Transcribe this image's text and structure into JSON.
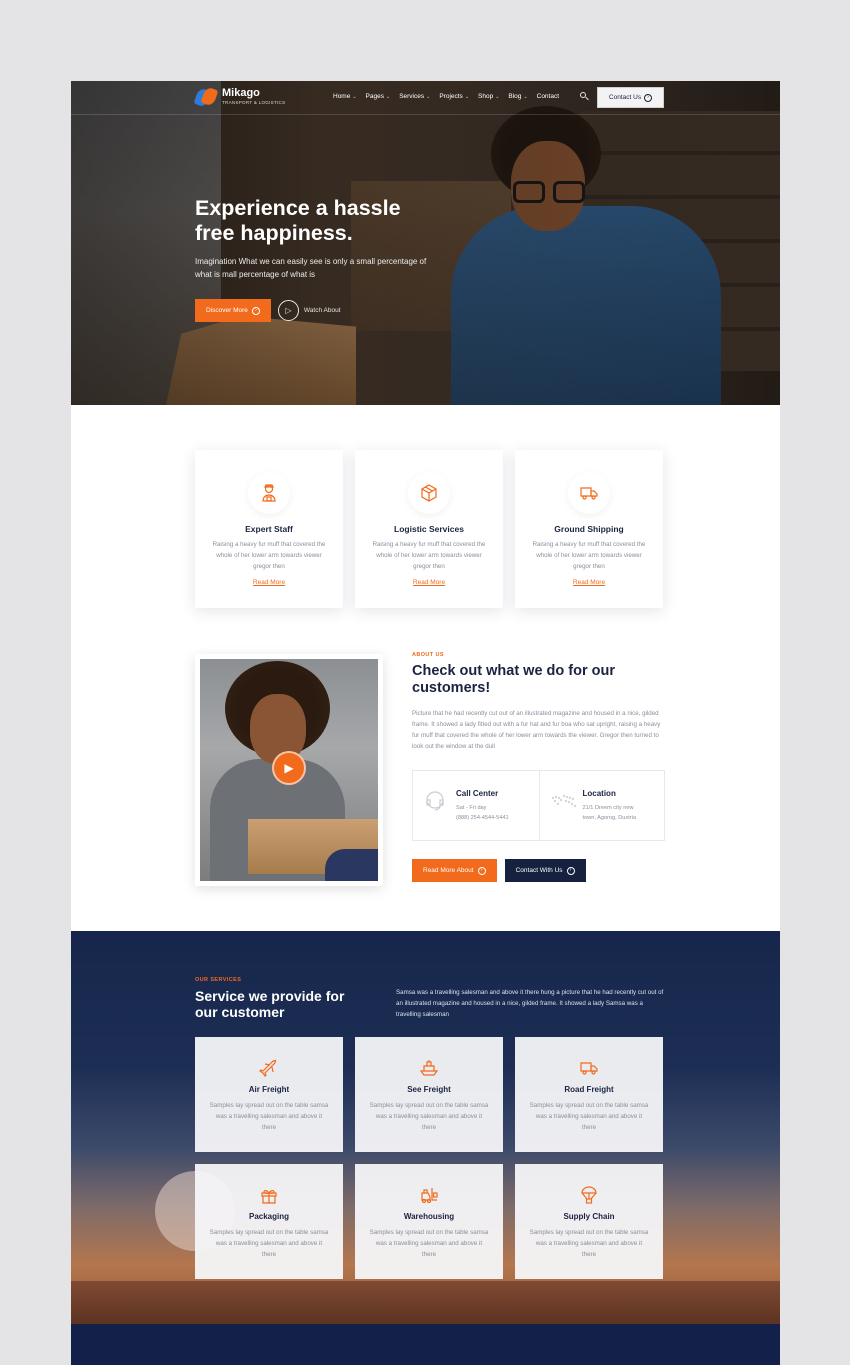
{
  "brand": {
    "name": "Mikago",
    "tagline": "TRANSPORT & LOGISTICS"
  },
  "nav": {
    "items": [
      {
        "label": "Home",
        "chevron": "⌄"
      },
      {
        "label": "Pages",
        "chevron": "⌄"
      },
      {
        "label": "Services",
        "chevron": "⌄"
      },
      {
        "label": "Projects",
        "chevron": "⌄"
      },
      {
        "label": "Shop",
        "chevron": "⌄"
      },
      {
        "label": "Blog",
        "chevron": "⌄"
      },
      {
        "label": "Contact",
        "chevron": ""
      }
    ],
    "contact_button": "Contact Us"
  },
  "hero": {
    "title_line1": "Experience a hassle",
    "title_line2": "free happiness.",
    "subtitle": "Imagination What we can easily see is only a small percentage of what is mall percentage of what is",
    "primary_button": "Discover More",
    "secondary_button": "Watch About"
  },
  "features": [
    {
      "title": "Expert Staff",
      "desc": "Raising a heavy fur muff that covered the whole of her lower arm towards viewer gregor then",
      "link": "Read More",
      "icon": "staff-icon"
    },
    {
      "title": "Logistic Services",
      "desc": "Raising a heavy fur muff that covered the whole of her lower arm towards viewer gregor then",
      "link": "Read More",
      "icon": "box-icon"
    },
    {
      "title": "Ground Shipping",
      "desc": "Raising a heavy fur muff that covered the whole of her lower arm towards viewer gregor then",
      "link": "Read More",
      "icon": "truck-icon"
    }
  ],
  "about": {
    "eyebrow": "ABOUT US",
    "title": "Check out what we do for our customers!",
    "desc": "Picture that he had recently cut out of an illustrated magazine and housed in a nice, gilded frame. It showed a lady fitted out with a fur hat and fur boa who sat upright, raising a heavy fur muff that covered the whole of her lower arm towards the viewer. Gregor then turned to look out the window at the dull",
    "call": {
      "title": "Call Center",
      "line1": "Sat - Fri day",
      "line2": "(888) 254-4544-5441"
    },
    "location": {
      "title": "Location",
      "line1": "21/1 Dreem city new",
      "line2": "town, Agorog, Dustria"
    },
    "primary_button": "Read More About",
    "secondary_button": "Contact With Us"
  },
  "services": {
    "eyebrow": "OUR SERVICES",
    "title": "Service we provide for our customer",
    "desc": "Samsa was a travelling salesman and above it there hung a picture that he had recently cut out of an illustrated magazine and housed in a nice, gilded frame. It showed a lady Samsa was a travelling salesman",
    "items": [
      {
        "title": "Air Freight",
        "desc": "Samples lay spread out on the table samsa was a travelling salesman and above it there",
        "icon": "plane-icon"
      },
      {
        "title": "See Freight",
        "desc": "Samples lay spread out on the table samsa was a travelling salesman and above it there",
        "icon": "ship-icon"
      },
      {
        "title": "Road Freight",
        "desc": "Samples lay spread out on the table samsa was a travelling salesman and above it there",
        "icon": "truck-icon"
      },
      {
        "title": "Packaging",
        "desc": "Samples lay spread out on the table samsa was a travelling salesman and above it there",
        "icon": "gift-icon"
      },
      {
        "title": "Warehousing",
        "desc": "Samples lay spread out on the table samsa was a travelling salesman and above it there",
        "icon": "forklift-icon"
      },
      {
        "title": "Supply Chain",
        "desc": "Samples lay spread out on the table samsa was a travelling salesman and above it there",
        "icon": "parachute-icon"
      }
    ]
  },
  "colors": {
    "accent": "#f26a1b",
    "navy": "#15213f",
    "text_muted": "#8a8f9c"
  }
}
